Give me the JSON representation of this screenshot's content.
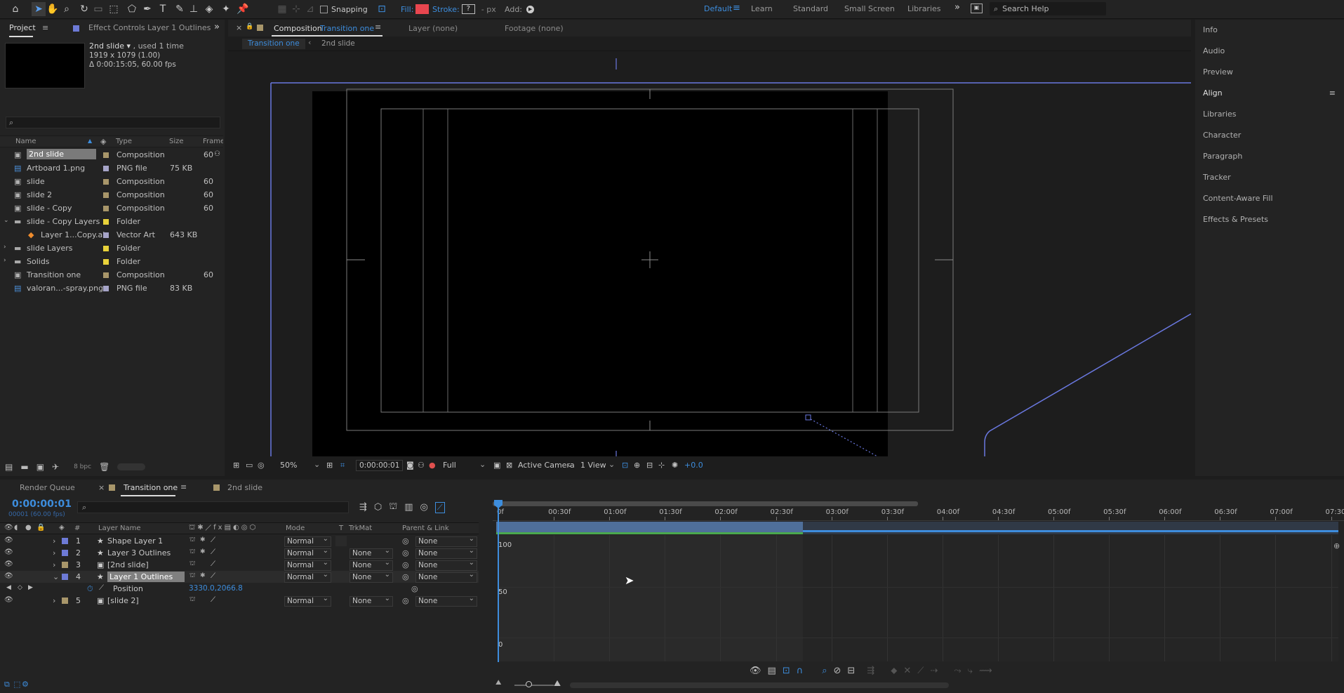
{
  "toolbar": {
    "snapping_label": "Snapping",
    "fill_label": "Fill:",
    "fill_color": "#e8464f",
    "stroke_label": "Stroke:",
    "stroke_value": "?",
    "stroke_units": "- px",
    "add_label": "Add:",
    "workspaces": [
      "Default",
      "Learn",
      "Standard",
      "Small Screen",
      "Libraries"
    ],
    "active_workspace": "Default",
    "search_placeholder": "Search Help"
  },
  "project_panel": {
    "tab_project": "Project",
    "tab_effect_controls": "Effect Controls Layer 1 Outlines",
    "selected_name": "2nd slide",
    "selected_used": ", used 1 time",
    "selected_dims": "1919 x 1079 (1.00)",
    "selected_duration": "Δ 0:00:15:05, 60.00 fps",
    "search_placeholder": "",
    "columns": [
      "Name",
      "Type",
      "Size",
      "Frame R"
    ],
    "items": [
      {
        "name": "2nd slide",
        "type": "Composition",
        "size": "",
        "frame": "60",
        "icon": "composition-icon",
        "label_color": "#a8966a",
        "selected": true
      },
      {
        "name": "Artboard 1.png",
        "type": "PNG file",
        "size": "75 KB",
        "frame": "",
        "icon": "png-file-icon",
        "label_color": "#a6a4c8"
      },
      {
        "name": "slide",
        "type": "Composition",
        "size": "",
        "frame": "60",
        "icon": "composition-icon",
        "label_color": "#a8966a"
      },
      {
        "name": "slide 2",
        "type": "Composition",
        "size": "",
        "frame": "60",
        "icon": "composition-icon",
        "label_color": "#a8966a"
      },
      {
        "name": "slide - Copy",
        "type": "Composition",
        "size": "",
        "frame": "60",
        "icon": "composition-icon",
        "label_color": "#a8966a"
      },
      {
        "name": "slide - Copy Layers",
        "type": "Folder",
        "size": "",
        "frame": "",
        "icon": "folder-icon",
        "label_color": "#e8d23a",
        "expanded": true
      },
      {
        "name": "Layer 1...Copy.ai",
        "type": "Vector Art",
        "size": "643 KB",
        "frame": "",
        "icon": "illustrator-file-icon",
        "label_color": "#a6a4c8",
        "indent": true
      },
      {
        "name": "slide Layers",
        "type": "Folder",
        "size": "",
        "frame": "",
        "icon": "folder-icon",
        "label_color": "#e8d23a"
      },
      {
        "name": "Solids",
        "type": "Folder",
        "size": "",
        "frame": "",
        "icon": "folder-icon",
        "label_color": "#e8d23a"
      },
      {
        "name": "Transition one",
        "type": "Composition",
        "size": "",
        "frame": "60",
        "icon": "composition-icon",
        "label_color": "#a8966a"
      },
      {
        "name": "valoran...-spray.png",
        "type": "PNG file",
        "size": "83 KB",
        "frame": "",
        "icon": "png-file-icon",
        "label_color": "#a6a4c8"
      }
    ],
    "bpc": "8 bpc"
  },
  "composition_panel": {
    "tab_label": "Composition",
    "tab_comp_name": "Transition one",
    "layer_tab": "Layer (none)",
    "footage_tab": "Footage (none)",
    "breadcrumb": [
      "Transition one",
      "2nd slide"
    ],
    "zoom": "50%",
    "timecode": "0:00:00:01",
    "resolution": "Full",
    "camera": "Active Camera",
    "views": "1 View",
    "exposure": "+0.0"
  },
  "right_panel": {
    "items": [
      "Info",
      "Audio",
      "Preview",
      "Align",
      "Libraries",
      "Character",
      "Paragraph",
      "Tracker",
      "Content-Aware Fill",
      "Effects & Presets"
    ],
    "active": "Align"
  },
  "timeline": {
    "tab_render_queue": "Render Queue",
    "tab_active": "Transition one",
    "tab_other": "2nd slide",
    "current_time": "0:00:00:01",
    "current_frame_info": "00001 (60.00 fps)",
    "columns": {
      "layer_name": "Layer Name",
      "mode": "Mode",
      "t": "T",
      "trkmat": "TrkMat",
      "parent": "Parent & Link"
    },
    "layers": [
      {
        "num": "1",
        "name": "Shape Layer 1",
        "icon": "star-icon",
        "label_color": "#6d7ad6",
        "mode": "Normal",
        "trkmat": "",
        "parent": "None"
      },
      {
        "num": "2",
        "name": "Layer 3 Outlines",
        "icon": "star-icon",
        "label_color": "#6d7ad6",
        "mode": "Normal",
        "trkmat": "None",
        "parent": "None"
      },
      {
        "num": "3",
        "name": "[2nd slide]",
        "icon": "composition-icon",
        "label_color": "#a8966a",
        "mode": "Normal",
        "trkmat": "None",
        "parent": "None"
      },
      {
        "num": "4",
        "name": "Layer 1 Outlines",
        "icon": "star-icon",
        "label_color": "#6d7ad6",
        "mode": "Normal",
        "trkmat": "None",
        "parent": "None",
        "selected": true
      },
      {
        "num": "5",
        "name": "[slide 2]",
        "icon": "composition-icon",
        "label_color": "#a8966a",
        "mode": "Normal",
        "trkmat": "None",
        "parent": "None"
      }
    ],
    "property": {
      "name": "Position",
      "value": "3330.0,2066.8"
    },
    "ruler": [
      "0f",
      "00:30f",
      "01:00f",
      "01:30f",
      "02:00f",
      "02:30f",
      "03:00f",
      "03:30f",
      "04:00f",
      "04:30f",
      "05:00f",
      "05:30f",
      "06:00f",
      "06:30f",
      "07:00f",
      "07:30"
    ],
    "graph_labels": [
      "100",
      "50",
      "0"
    ]
  }
}
